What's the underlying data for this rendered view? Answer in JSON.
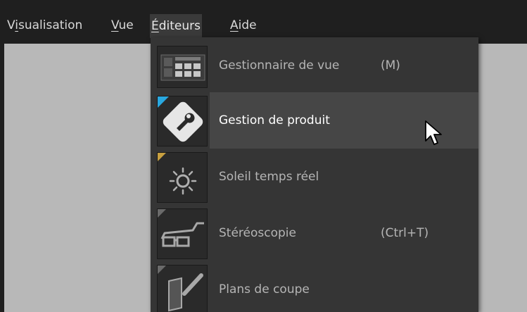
{
  "menubar": {
    "items": [
      {
        "pre": "V",
        "u": "i",
        "post": "sualisation"
      },
      {
        "pre": "",
        "u": "V",
        "post": "ue"
      },
      {
        "pre": "",
        "u": "É",
        "post": "diteurs"
      },
      {
        "pre": "",
        "u": "A",
        "post": "ide"
      }
    ]
  },
  "dropdown": {
    "items": [
      {
        "label": "Gestionnaire de vue",
        "shortcut": "(M)",
        "icon": "view-manager-icon",
        "state": "normal"
      },
      {
        "label": "Gestion de produit",
        "shortcut": "",
        "icon": "wrench-icon",
        "state": "hover"
      },
      {
        "label": "Soleil temps réel",
        "shortcut": "",
        "icon": "sun-icon",
        "state": "normal"
      },
      {
        "label": "Stéréoscopie",
        "shortcut": "(Ctrl+T)",
        "icon": "3d-glasses-icon",
        "state": "normal"
      },
      {
        "label": "Plans de coupe",
        "shortcut": "",
        "icon": "clipping-plane-icon",
        "state": "normal"
      }
    ]
  },
  "colors": {
    "menubar_bg": "#1f1f1f",
    "menu_bg": "#353535",
    "hover_bg": "#464646",
    "workspace_bg": "#b8b8b8",
    "accent_cyan": "#29a8e0",
    "accent_gold": "#c8a040"
  }
}
